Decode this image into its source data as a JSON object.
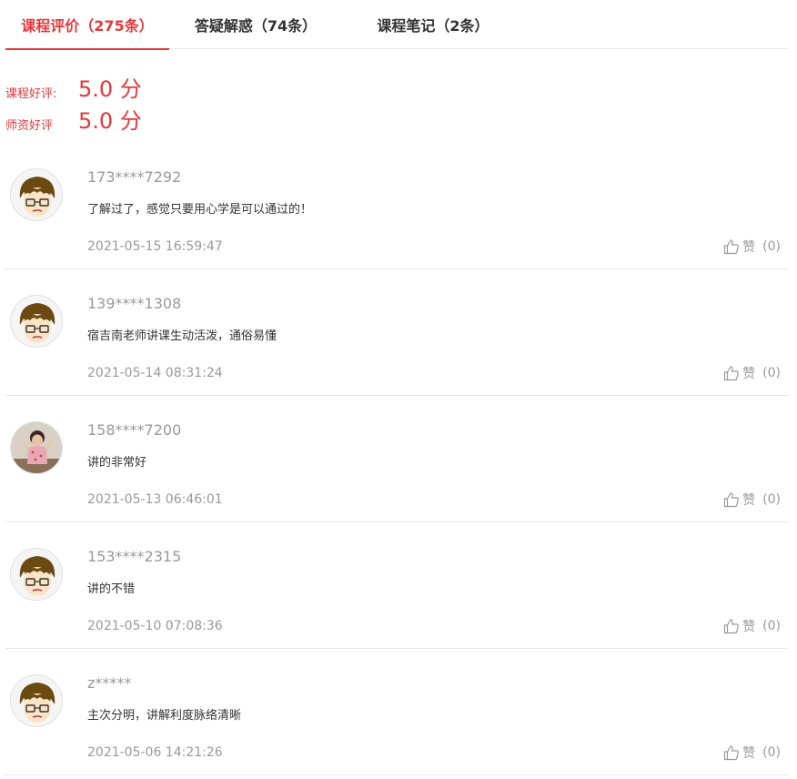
{
  "tabs": [
    {
      "label": "课程评价（275条）",
      "active": true
    },
    {
      "label": "答疑解惑（74条）",
      "active": false
    },
    {
      "label": "课程笔记（2条）",
      "active": false
    }
  ],
  "ratings": {
    "course_label": "课程好评:",
    "course_value": "5.0 分",
    "teacher_label": "师资好评",
    "teacher_value": "5.0 分"
  },
  "reviews": [
    {
      "user": "173****7292",
      "content": "了解过了，感觉只要用心学是可以通过的！",
      "time": "2021-05-15 16:59:47",
      "like_label": "赞",
      "like_count": "(0)",
      "avatar": "cartoon-boy"
    },
    {
      "user": "139****1308",
      "content": "宿吉南老师讲课生动活泼，通俗易懂",
      "time": "2021-05-14 08:31:24",
      "like_label": "赞",
      "like_count": "(0)",
      "avatar": "cartoon-boy"
    },
    {
      "user": "158****7200",
      "content": "讲的非常好",
      "time": "2021-05-13 06:46:01",
      "like_label": "赞",
      "like_count": "(0)",
      "avatar": "child-photo"
    },
    {
      "user": "153****2315",
      "content": "讲的不错",
      "time": "2021-05-10 07:08:36",
      "like_label": "赞",
      "like_count": "(0)",
      "avatar": "cartoon-boy"
    },
    {
      "user": "z*****",
      "content": "主次分明，讲解利度脉络清晰",
      "time": "2021-05-06 14:21:26",
      "like_label": "赞",
      "like_count": "(0)",
      "avatar": "cartoon-boy"
    }
  ],
  "colors": {
    "accent": "#e4393c",
    "muted": "#999999",
    "text": "#333333",
    "divider": "#e5e5e5"
  },
  "icons": {
    "like": "thumbs-up-icon"
  }
}
